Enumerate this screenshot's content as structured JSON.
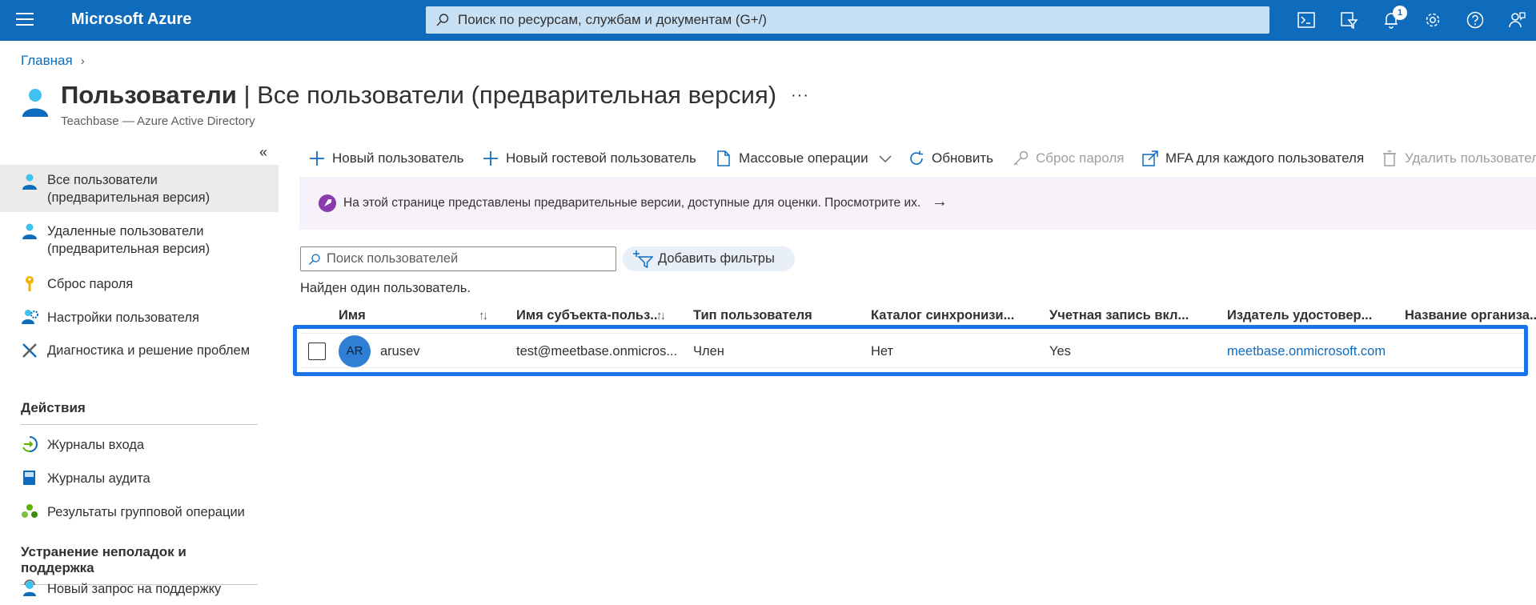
{
  "topbar": {
    "brand": "Microsoft Azure",
    "search_placeholder": "Поиск по ресурсам, службам и документам (G+/)",
    "notifications_count": "1",
    "icons": [
      "cloud-shell-icon",
      "directory-filter-icon",
      "bell-icon",
      "gear-icon",
      "help-icon",
      "feedback-icon"
    ],
    "bar_color": "#0f6cbd"
  },
  "header": {
    "breadcrumb": "Главная",
    "title_main": "Пользователи",
    "title_sep": " | ",
    "title_rest": "Все пользователи (предварительная версия)",
    "more": "···",
    "subtitle": "Teachbase — Azure Active Directory"
  },
  "sidebar": {
    "collapse": "«",
    "items": [
      {
        "label": "Все пользователи (предварительная версия)",
        "icon": "user-icon",
        "active": true
      },
      {
        "label": "Удаленные пользователи (предварительная версия)",
        "icon": "deleted-user-icon"
      },
      {
        "label": "Сброс пароля",
        "icon": "key-icon"
      },
      {
        "label": "Настройки пользователя",
        "icon": "user-settings-icon"
      },
      {
        "label": "Диагностика и решение проблем",
        "icon": "wrench-icon"
      }
    ],
    "section_actions": "Действия",
    "actions": [
      {
        "label": "Журналы входа",
        "icon": "sign-in-icon"
      },
      {
        "label": "Журналы аудита",
        "icon": "book-icon"
      },
      {
        "label": "Результаты групповой операции",
        "icon": "group-icon"
      }
    ],
    "section_support": "Устранение неполадок и поддержка",
    "support": [
      {
        "label": "Новый запрос на поддержку",
        "icon": "support-icon"
      }
    ]
  },
  "commands": {
    "new_user": "Новый пользователь",
    "new_guest": "Новый гостевой пользователь",
    "bulk": "Массовые операции",
    "refresh": "Обновить",
    "reset_password": "Сброс пароля",
    "mfa": "MFA для каждого пользователя",
    "delete": "Удалить пользователя"
  },
  "banner": {
    "text": "На этой странице представлены предварительные версии, доступные для оценки. Просмотрите их.",
    "arrow": "→",
    "accent": "#8a3cad"
  },
  "filters": {
    "search_placeholder": "Поиск пользователей",
    "add_filter": "Добавить фильтры",
    "found": "Найден один пользователь."
  },
  "table": {
    "columns": [
      "Имя",
      "Имя субъекта-польз...",
      "Тип пользователя",
      "Каталог синхронизи...",
      "Учетная запись вкл...",
      "Издатель удостовер...",
      "Название организа..."
    ],
    "rows": [
      {
        "initials": "AR",
        "name": "arusev",
        "upn": "test@meetbase.onmicros...",
        "type": "Член",
        "synced": "Нет",
        "enabled": "Yes",
        "issuer": "meetbase.onmicrosoft.com",
        "org": ""
      }
    ],
    "highlight_color": "#1a73e8"
  }
}
